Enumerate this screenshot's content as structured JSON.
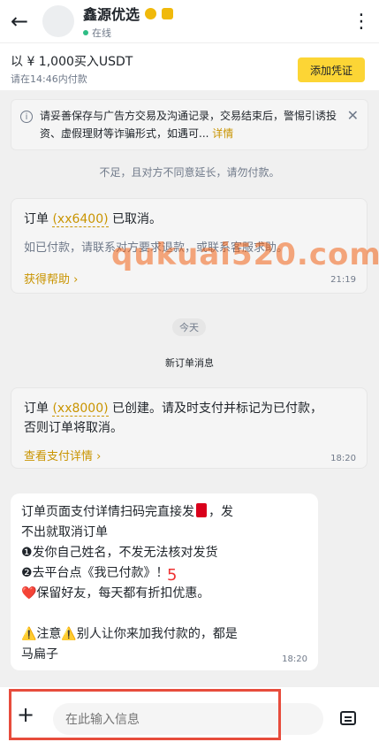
{
  "header": {
    "back_icon": "arrow-left-icon",
    "title": "鑫源优选",
    "status": "在线",
    "more_icon": "more-vertical-icon"
  },
  "order": {
    "title": "以 ¥ 1,000买入USDT",
    "subtitle": "请在14:46内付款",
    "add_button": "添加凭证"
  },
  "notice": {
    "text": "请妥善保存与广告方交易及沟通记录，交易结束后，警惕引诱投资、虚假理财等诈骗形式，如遇可...",
    "link": "详情"
  },
  "messages": {
    "system_partial": "不足，且对方不同意延长，请勿付款。",
    "cancel_card": {
      "prefix": "订单",
      "order_no": "(xx6400)",
      "suffix": "已取消。",
      "body": "如已付款，请联系对方要求退款，或联系客服求助。",
      "link": "获得帮助",
      "time": "21:19"
    },
    "date_divider": "今天",
    "new_order_label": "新订单消息",
    "create_card": {
      "prefix": "订单",
      "order_no": "(xx8000)",
      "suffix": "已创建。请及时支付并标记为已付款，",
      "line2": "否则订单将取消。",
      "link": "查看支付详情",
      "time": "18:20"
    },
    "seller_msg": {
      "line1_a": "订单页面支付详情扫码完直接发",
      "line1_b": "，发",
      "line2": "不出就取消订单",
      "line3": "❶发你自己姓名，不发无法核对发货",
      "line4": "❷去平台点《我已付款》！",
      "line5": "❤️保留好友，每天都有折扣优惠。",
      "line6": "⚠️注意⚠️别人让你来加我付款的，都是",
      "line7": "马扁子",
      "time": "18:20"
    }
  },
  "overlays": {
    "watermark": "qukuai520.com",
    "annotation": "5"
  },
  "input": {
    "placeholder": "在此输入信息"
  }
}
